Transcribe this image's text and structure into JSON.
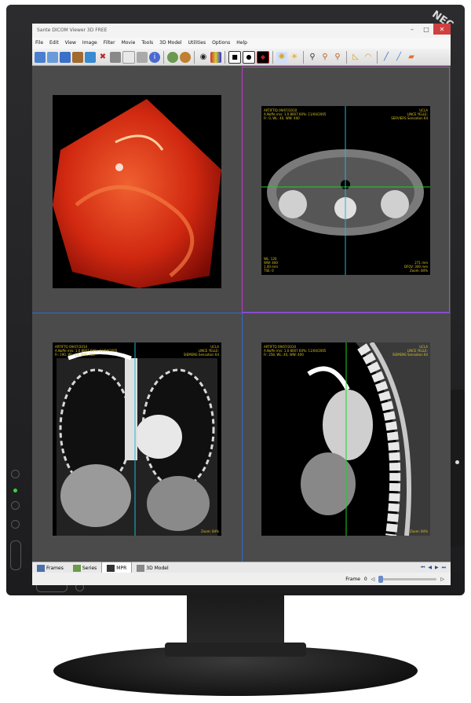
{
  "monitor": {
    "brand": "NEC"
  },
  "window": {
    "title": "Sante DICOM Viewer 3D FREE"
  },
  "menu": [
    "File",
    "Edit",
    "View",
    "Image",
    "Filter",
    "Movie",
    "Tools",
    "3D Model",
    "Utilities",
    "Options",
    "Help"
  ],
  "toolbar": {
    "icons": [
      "open-folder-icon",
      "open-cd-icon",
      "open-dicomdir-icon",
      "save-icon",
      "export-icon",
      "delete-icon",
      "print-icon",
      "copy-icon",
      "report-icon",
      "info-icon",
      "sep",
      "settings-icon",
      "network-icon",
      "sep",
      "eye-icon",
      "palette-icon",
      "sep",
      "invert-icon",
      "contrast-icon",
      "mpr-icon",
      "sep",
      "brightness-icon",
      "sun-icon",
      "sep",
      "zoom-icon",
      "zoom-in-icon",
      "zoom-out-icon",
      "sep",
      "ruler-icon",
      "angle-icon",
      "sep",
      "pen-icon",
      "eraser-icon"
    ]
  },
  "viewports": {
    "top_right": {
      "top_left": [
        "ARTIFTIQ 09/07/2010",
        "A.Noffe m/s: 1.0 8007 60%: 11/04/2005",
        "Fr: 0, WL: 40, WW: 400"
      ],
      "top_right": [
        "UCLA",
        "LINCE YELLE:",
        "SERVIERS Sensation 64"
      ],
      "bottom_left": [
        "WL: 120",
        "WW: 400",
        "1.00 mm",
        "TSE: 0"
      ],
      "bottom_right": [
        "271 mm",
        "DFOV: 300 mm",
        "Zoom: 84%"
      ]
    },
    "bottom_left": {
      "top_left": [
        "ARTIFTQ 09/07/2010",
        "A.Noffe m/s: 1.0 8007 60%: 11/04/2005",
        "Fr: 190, WL: 40, WW: 400"
      ],
      "top_right": [
        "UCLA",
        "LINCE YELLE:",
        "SIEMENS Sensation 64"
      ],
      "bottom_right": [
        "Zoom: 84%"
      ]
    },
    "bottom_right": {
      "top_left": [
        "ARTIFTQ 09/07/2010",
        "A.Noffe m/s: 1.0 8007 60%: 11/04/2005",
        "Fr: 258, WL: 40, WW: 400"
      ],
      "top_right": [
        "UCLA",
        "LINCE YELLE:",
        "SIEMENS Sensation 64"
      ],
      "bottom_right": [
        "Zoom: 84%"
      ]
    }
  },
  "tabs": [
    {
      "label": "Frames",
      "icon": "frames-icon"
    },
    {
      "label": "Series",
      "icon": "series-icon"
    },
    {
      "label": "MPR",
      "icon": "mpr-tab-icon"
    },
    {
      "label": "3D Model",
      "icon": "model-3d-icon"
    }
  ],
  "status": {
    "frame_label": "Frame",
    "frame_value": "0"
  }
}
